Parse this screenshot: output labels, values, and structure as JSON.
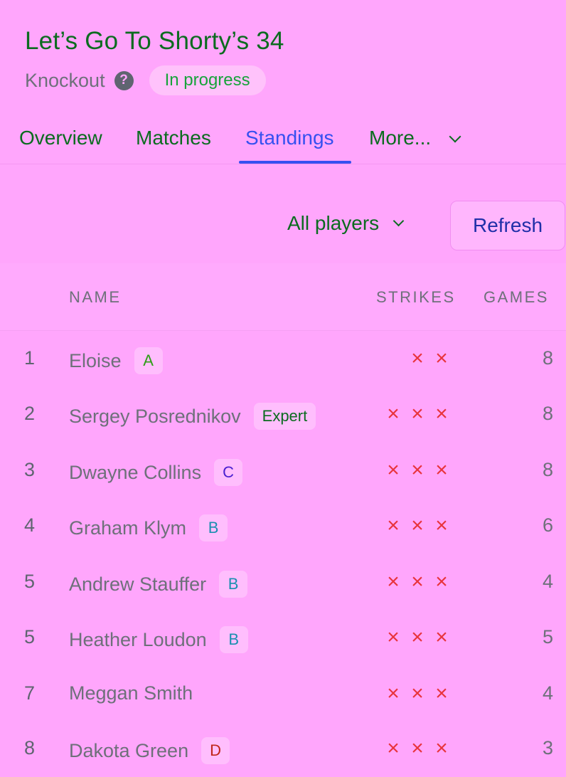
{
  "header": {
    "title": "Let’s Go To Shorty’s 34",
    "type": "Knockout",
    "help_icon": "?",
    "status": "In progress"
  },
  "tabs": [
    {
      "label": "Overview"
    },
    {
      "label": "Matches"
    },
    {
      "label": "Standings",
      "active": true
    },
    {
      "label": "More..."
    }
  ],
  "toolbar": {
    "filter_label": "All players",
    "refresh_label": "Refresh"
  },
  "table": {
    "columns": {
      "name": "NAME",
      "strikes": "STRIKES",
      "games": "GAMES"
    },
    "strike_icon": "×",
    "rows": [
      {
        "rank": "1",
        "name": "Eloise",
        "badge": "A",
        "strikes": 2,
        "games": "8"
      },
      {
        "rank": "2",
        "name": "Sergey Posrednikov",
        "badge": "Expert",
        "strikes": 3,
        "games": "8"
      },
      {
        "rank": "3",
        "name": "Dwayne Collins",
        "badge": "C",
        "strikes": 3,
        "games": "8"
      },
      {
        "rank": "4",
        "name": "Graham Klym",
        "badge": "B",
        "strikes": 3,
        "games": "6"
      },
      {
        "rank": "5",
        "name": "Andrew Stauffer",
        "badge": "B",
        "strikes": 3,
        "games": "4"
      },
      {
        "rank": "5",
        "name": "Heather Loudon",
        "badge": "B",
        "strikes": 3,
        "games": "5"
      },
      {
        "rank": "7",
        "name": "Meggan Smith",
        "badge": "",
        "strikes": 3,
        "games": "4"
      },
      {
        "rank": "8",
        "name": "Dakota Green",
        "badge": "D",
        "strikes": 3,
        "games": "3"
      }
    ]
  },
  "colors": {
    "background": "#ffa6fc",
    "accent": "#3550f0",
    "title": "#0b6b1f",
    "status": "#17a33a",
    "strike": "#e8343c",
    "badge_A": "#2e9e16",
    "badge_B": "#1a8fb0",
    "badge_C": "#4a1fd0",
    "badge_D": "#c0261a",
    "badge_Expert": "#0b6b1f"
  }
}
